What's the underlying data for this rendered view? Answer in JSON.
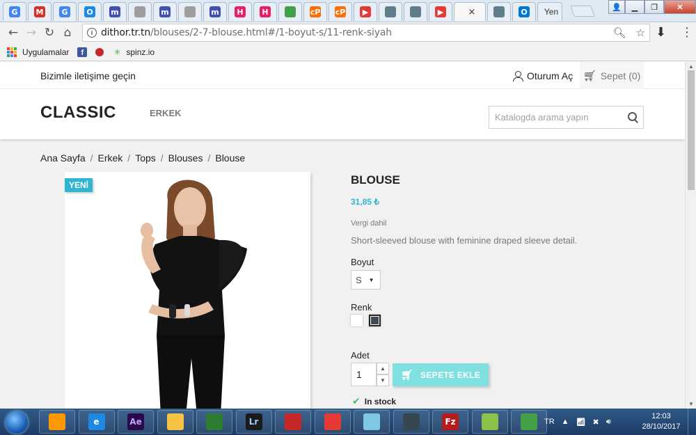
{
  "browser": {
    "tabs": [
      {
        "icon": "google-icon",
        "glyph": "G",
        "color": "#4285f4"
      },
      {
        "icon": "gmail-icon",
        "glyph": "M",
        "color": "#d93025"
      },
      {
        "icon": "google-icon",
        "glyph": "G",
        "color": "#4285f4"
      },
      {
        "icon": "circle-app-icon",
        "glyph": "O",
        "color": "#1e88e5"
      },
      {
        "icon": "m-logo-icon",
        "glyph": "m",
        "color": "#3f51b5"
      },
      {
        "icon": "document-icon",
        "glyph": "",
        "color": "#9e9e9e"
      },
      {
        "icon": "m-logo-icon",
        "glyph": "m",
        "color": "#3f51b5"
      },
      {
        "icon": "document-icon",
        "glyph": "",
        "color": "#9e9e9e"
      },
      {
        "icon": "m-logo-icon",
        "glyph": "m",
        "color": "#3f51b5"
      },
      {
        "icon": "h-logo-icon",
        "glyph": "H",
        "color": "#e91e63"
      },
      {
        "icon": "h-logo-icon",
        "glyph": "H",
        "color": "#e91e63"
      },
      {
        "icon": "puzzle-icon",
        "glyph": "",
        "color": "#43a047"
      },
      {
        "icon": "cp-logo-icon",
        "glyph": "cP",
        "color": "#ff6d00"
      },
      {
        "icon": "cp-logo-icon",
        "glyph": "cP",
        "color": "#ff6d00"
      },
      {
        "icon": "youtube-icon",
        "glyph": "▶",
        "color": "#e53935"
      },
      {
        "icon": "eye-icon",
        "glyph": "",
        "color": "#607d8b"
      },
      {
        "icon": "eye-icon",
        "glyph": "",
        "color": "#607d8b"
      },
      {
        "icon": "youtube-icon",
        "glyph": "▶",
        "color": "#e53935"
      }
    ],
    "active_tab_close": "×",
    "tabs_after": [
      {
        "icon": "eye-icon",
        "glyph": "",
        "color": "#607d8b"
      },
      {
        "icon": "outlook-icon",
        "glyph": "O",
        "color": "#0078d4"
      }
    ],
    "last_tab_label": "Yen",
    "url_host": "dithor.tr.tn",
    "url_path": "/blouses/2-7-blouse.html#/1-boyut-s/11-renk-siyah",
    "bookmarks": [
      {
        "label": "Uygulamalar",
        "icon": "apps-grid-icon"
      },
      {
        "label": "",
        "icon": "facebook-icon"
      },
      {
        "label": "",
        "icon": "ladybug-icon"
      },
      {
        "label": "spinz.io",
        "icon": "spinz-icon"
      }
    ]
  },
  "site": {
    "contact": "Bizimle iletişime geçin",
    "signin": "Oturum Aç",
    "cart": "Sepet (0)",
    "logo": "CLASSIC",
    "nav_item": "ERKEK",
    "search_placeholder": "Katalogda arama yapın"
  },
  "breadcrumb": [
    "Ana Sayfa",
    "Erkek",
    "Tops",
    "Blouses",
    "Blouse"
  ],
  "product": {
    "flag": "YENİ",
    "title": "BLOUSE",
    "price": "31,85 ₺",
    "tax": "Vergi dahil",
    "description": "Short-sleeved blouse with feminine draped sleeve detail.",
    "size_label": "Boyut",
    "size_value": "S",
    "color_label": "Renk",
    "colors": [
      {
        "name": "white",
        "hex": "#ffffff"
      },
      {
        "name": "black",
        "hex": "#434a54"
      }
    ],
    "qty_label": "Adet",
    "qty_value": "1",
    "add_to_cart": "SEPETE EKLE",
    "stock": "In stock"
  },
  "taskbar": {
    "apps": [
      "media-player-icon",
      "internet-explorer-icon",
      "after-effects-icon",
      "folder-icon",
      "camtasia-icon",
      "lightroom-icon",
      "red-app-icon",
      "chrome-icon",
      "notepad-icon",
      "monitor-app-icon",
      "filezilla-icon",
      "editor-app-icon",
      "green-app-icon"
    ],
    "app_labels": [
      "",
      "e",
      "Ae",
      "",
      "",
      "Lr",
      "",
      "",
      "",
      "",
      "Fz",
      "",
      ""
    ],
    "language": "TR",
    "time": "12:03",
    "date": "28/10/2017"
  },
  "colors": {
    "accent": "#2fb5d2",
    "add_cart_bg": "#7fe0df",
    "text_dark": "#232323",
    "text_muted": "#7a7a7a"
  }
}
